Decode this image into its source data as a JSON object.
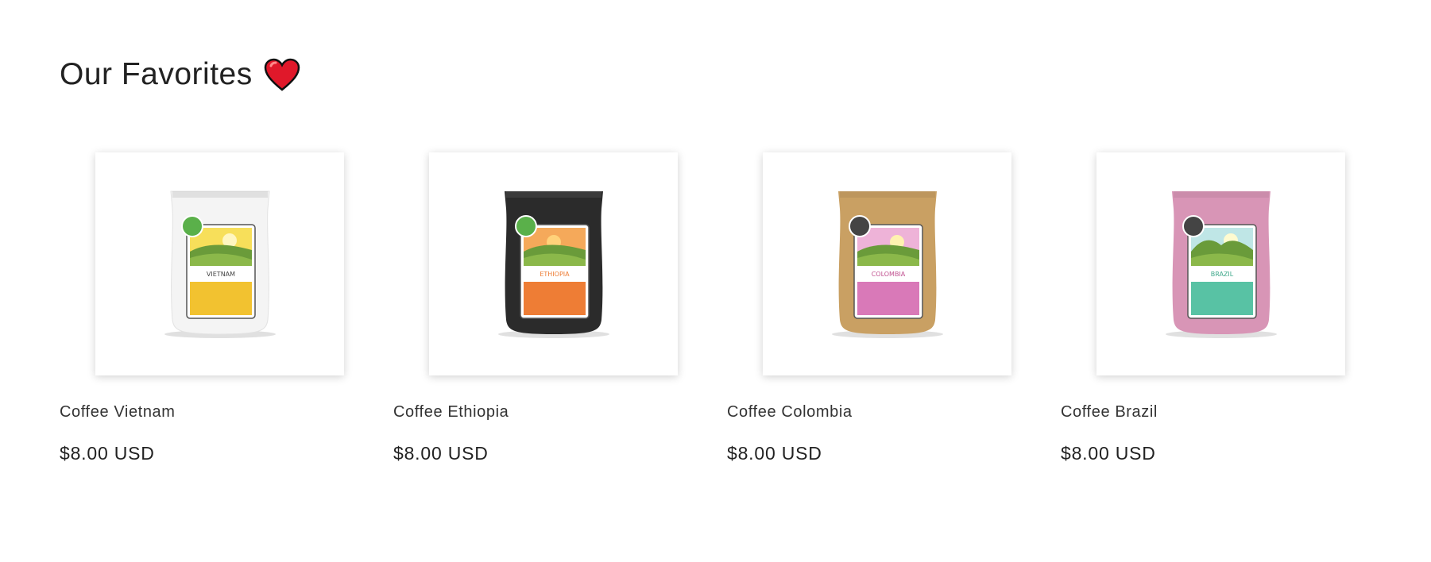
{
  "section": {
    "title": "Our Favorites",
    "title_icon": "heart-icon"
  },
  "products": [
    {
      "name": "Coffee Vietnam",
      "price": "$8.00 USD",
      "origin_label": "VIETNAM",
      "bag_color": "#f4f4f4",
      "label_color": "#f2c230",
      "sky_color": "#f7df5a"
    },
    {
      "name": "Coffee Ethiopia",
      "price": "$8.00 USD",
      "origin_label": "ETHIOPIA",
      "bag_color": "#2b2b2b",
      "label_color": "#ee7d35",
      "sky_color": "#f5a95a"
    },
    {
      "name": "Coffee Colombia",
      "price": "$8.00 USD",
      "origin_label": "COLOMBIA",
      "bag_color": "#c9a063",
      "label_color": "#d979b8",
      "sky_color": "#eeb3d8"
    },
    {
      "name": "Coffee Brazil",
      "price": "$8.00 USD",
      "origin_label": "BRAZIL",
      "bag_color": "#d895b6",
      "label_color": "#58c2a4",
      "sky_color": "#bfe6e6"
    }
  ]
}
